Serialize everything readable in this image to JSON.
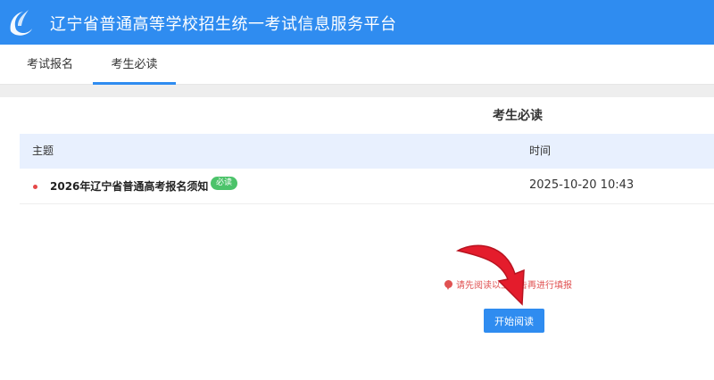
{
  "header": {
    "title": "辽宁省普通高等学校招生统一考试信息服务平台",
    "logo_icon": "swoosh-logo-icon"
  },
  "tabs": [
    {
      "label": "考试报名",
      "active": false
    },
    {
      "label": "考生必读",
      "active": true
    }
  ],
  "panel": {
    "title": "考生必读",
    "columns": {
      "subject": "主题",
      "time": "时间"
    },
    "rows": [
      {
        "title": "2026年辽宁省普通高考报名须知",
        "badge": "必读",
        "time": "2025-10-20 10:43"
      }
    ],
    "notice": "请先阅读以上公告再进行填报",
    "button_label": "开始阅读"
  },
  "colors": {
    "header_bg": "#2f8cf0",
    "table_head_bg": "#e8f0fe",
    "badge_bg": "#4cc36a",
    "notice_red": "#e05252",
    "arrow_red": "#e41c2c"
  }
}
